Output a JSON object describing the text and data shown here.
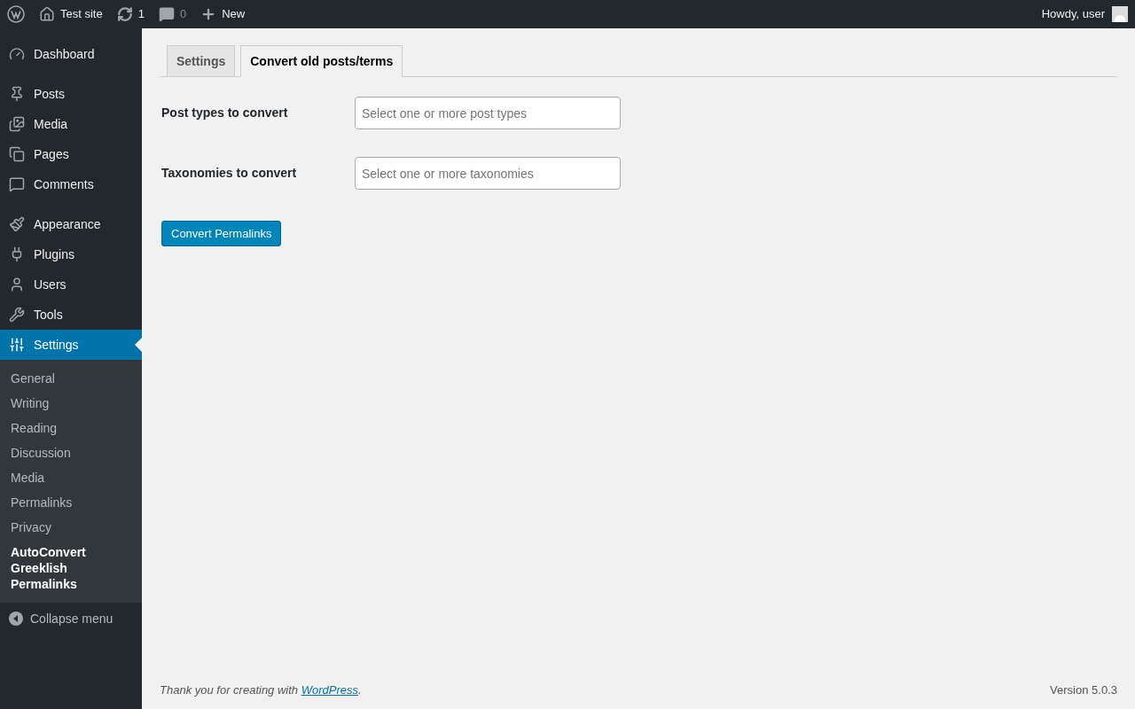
{
  "admin_bar": {
    "site": "Test site",
    "updates": "1",
    "comments": "0",
    "new": "New",
    "greeting": "Howdy, user"
  },
  "sidebar": {
    "groups": [
      [
        {
          "label": "Dashboard",
          "selected": false
        }
      ],
      [
        {
          "label": "Posts",
          "selected": false
        },
        {
          "label": "Media",
          "selected": false
        },
        {
          "label": "Pages",
          "selected": false
        },
        {
          "label": "Comments",
          "selected": false
        }
      ],
      [
        {
          "label": "Appearance",
          "selected": false
        },
        {
          "label": "Plugins",
          "selected": false
        },
        {
          "label": "Users",
          "selected": false
        },
        {
          "label": "Tools",
          "selected": false
        },
        {
          "label": "Settings",
          "selected": true
        }
      ]
    ],
    "submenu": [
      {
        "label": "General",
        "selected": false
      },
      {
        "label": "Writing",
        "selected": false
      },
      {
        "label": "Reading",
        "selected": false
      },
      {
        "label": "Discussion",
        "selected": false
      },
      {
        "label": "Media",
        "selected": false
      },
      {
        "label": "Permalinks",
        "selected": false
      },
      {
        "label": "Privacy",
        "selected": false
      },
      {
        "label": "AutoConvert Greeklish Permalinks",
        "selected": true
      }
    ],
    "collapse": "Collapse menu"
  },
  "tabs": [
    {
      "label": "Settings",
      "selected": false
    },
    {
      "label": "Convert old posts/terms",
      "selected": true
    }
  ],
  "fields": [
    {
      "label": "Post types to convert",
      "placeholder": "Select one or more post types"
    },
    {
      "label": "Taxonomies to convert",
      "placeholder": "Select one or more taxonomies"
    }
  ],
  "button": "Convert Permalinks",
  "footer": {
    "before": "Thank you for creating with ",
    "link": "WordPress",
    "after": ".",
    "version": "Version 5.0.3"
  }
}
